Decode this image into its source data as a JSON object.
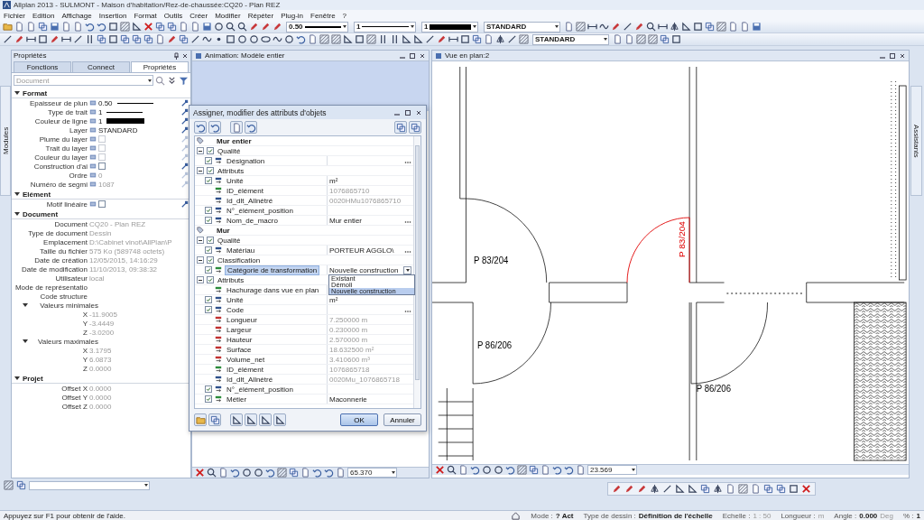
{
  "window": {
    "title": "Allplan 2013 - SULMONT - Maison d'habitation/Rez-de-chaussée:CQ20 - Plan REZ"
  },
  "menu": [
    "Fichier",
    "Edition",
    "Affichage",
    "Insertion",
    "Format",
    "Outils",
    "Créer",
    "Modifier",
    "Répéter",
    "Plug-in",
    "Fenêtre",
    "?"
  ],
  "toolbar_fields": [
    {
      "kind": "thickness",
      "value": "0.50"
    },
    {
      "kind": "linetype",
      "value": "1"
    },
    {
      "kind": "color",
      "value": "1",
      "color": "#000000"
    },
    {
      "kind": "layer",
      "value": "STANDARD"
    }
  ],
  "toolbar2_field": "STANDARD",
  "side_tabs": {
    "left": "Modules",
    "right": "Assistants"
  },
  "properties": {
    "title": "Propriétés",
    "tabs": [
      {
        "label": "Fonctions",
        "selected": false
      },
      {
        "label": "Connect",
        "selected": false
      },
      {
        "label": "Propriétés",
        "selected": true
      }
    ],
    "filter": "Document",
    "sections": [
      {
        "title": "Format",
        "kind": "format",
        "expanded": true,
        "rows": [
          {
            "kind": "line",
            "label": "Epaisseur de plun",
            "value": "0.50",
            "disabled": false
          },
          {
            "kind": "line",
            "label": "Type de trait",
            "value": "1",
            "disabled": false
          },
          {
            "kind": "color",
            "label": "Couleur de ligne",
            "value": "1",
            "color": "#000000",
            "disabled": false
          },
          {
            "kind": "text",
            "label": "Layer",
            "value": "STANDARD",
            "disabled": false
          },
          {
            "kind": "checkbox",
            "label": "Plume du layer",
            "checked": false,
            "disabled": true
          },
          {
            "kind": "checkbox",
            "label": "Trait du layer",
            "checked": false,
            "disabled": true
          },
          {
            "kind": "checkbox",
            "label": "Couleur du layer",
            "checked": false,
            "disabled": true
          },
          {
            "kind": "checkbox",
            "label": "Construction d'ai",
            "checked": false,
            "disabled": false
          },
          {
            "kind": "text",
            "label": "Ordre",
            "value": "0",
            "disabled": true
          },
          {
            "kind": "text",
            "label": "Numéro de segmi",
            "value": "1087",
            "disabled": true
          }
        ]
      },
      {
        "title": "Elément",
        "kind": "format",
        "expanded": true,
        "rows": [
          {
            "kind": "checkbox",
            "label": "Motif linéaire",
            "checked": false,
            "disabled": false
          }
        ]
      },
      {
        "title": "Document",
        "kind": "info",
        "expanded": true,
        "rows": [
          {
            "kind": "text",
            "label": "Document",
            "value": "CQ20 - Plan REZ",
            "disabled": true
          },
          {
            "kind": "text",
            "label": "Type de document",
            "value": "Dessin",
            "disabled": true
          },
          {
            "kind": "text",
            "label": "Emplacement",
            "value": "D:\\Cabinet vinot\\AllPlan\\P",
            "disabled": true
          },
          {
            "kind": "text",
            "label": "Taille du fichier",
            "value": "575 Ko (589748 octets)",
            "disabled": true
          },
          {
            "kind": "text",
            "label": "Date de création",
            "value": "12/05/2015, 14:16:29",
            "disabled": true
          },
          {
            "kind": "text",
            "label": "Date de modification",
            "value": "11/10/2013, 09:38:32",
            "disabled": true
          },
          {
            "kind": "text",
            "label": "Utilisateur",
            "value": "local",
            "disabled": true
          },
          {
            "kind": "text",
            "label": "Mode de représentatio"
          },
          {
            "kind": "text",
            "label": "Code structure"
          },
          {
            "kind": "group",
            "label": "Valeurs minimales",
            "expanded": true,
            "children": [
              {
                "label": "X",
                "value": "-11.9005",
                "disabled": true
              },
              {
                "label": "Y",
                "value": "-3.4449",
                "disabled": true
              },
              {
                "label": "Z",
                "value": "-3.0200",
                "disabled": true
              }
            ]
          },
          {
            "kind": "group",
            "label": "Valeurs maximales",
            "expanded": true,
            "children": [
              {
                "label": "X",
                "value": "3.1795",
                "disabled": true
              },
              {
                "label": "Y",
                "value": "6.0873",
                "disabled": true
              },
              {
                "label": "Z",
                "value": "0.0000",
                "disabled": true
              }
            ]
          }
        ]
      },
      {
        "title": "Projet",
        "kind": "info",
        "expanded": true,
        "rows": [
          {
            "kind": "text",
            "label": "Offset X",
            "value": "0.0000",
            "disabled": true
          },
          {
            "kind": "text",
            "label": "Offset Y",
            "value": "0.0000",
            "disabled": true
          },
          {
            "kind": "text",
            "label": "Offset Z",
            "value": "0.0000",
            "disabled": true
          }
        ]
      }
    ]
  },
  "animation_window": {
    "title": "Animation: Modèle entier",
    "zoom_field": "65.370"
  },
  "plan_window": {
    "title": "Vue en plan:2",
    "zoom_field": "23.569",
    "labels": [
      {
        "text": "P 83/204",
        "selected": false
      },
      {
        "text": "P 83/204",
        "selected": true
      },
      {
        "text": "P 86/206",
        "selected": false
      },
      {
        "text": "P 86/206",
        "selected": false
      }
    ]
  },
  "dialog": {
    "title": "Assigner, modifier des attributs d'objets",
    "objects": [
      {
        "label": "Mur entier",
        "groups": [
          {
            "label": "Qualité",
            "expanded": true,
            "checked": true,
            "children": [
              {
                "kind": "text",
                "label": "Désignation",
                "checked": true,
                "ellipsis": true,
                "selected": false
              }
            ]
          },
          {
            "label": "Attributs",
            "expanded": true,
            "checked": true,
            "children": [
              {
                "kind": "text",
                "label": "Unité",
                "checked": true,
                "value": "m²",
                "disabled": false,
                "ellipsis": false,
                "selected": false
              },
              {
                "kind": "number",
                "label": "ID_élément",
                "value": "1076865710",
                "disabled": true,
                "ellipsis": false,
                "selected": false
              },
              {
                "kind": "text",
                "label": "Id_dlt_Allnétré",
                "value": "0020HMu1076865710",
                "disabled": true,
                "ellipsis": false,
                "selected": false
              },
              {
                "kind": "text",
                "label": "N°_élément_position",
                "checked": true,
                "ellipsis": false,
                "selected": false
              },
              {
                "kind": "text",
                "label": "Nom_de_macro",
                "checked": true,
                "value": "Mur entier",
                "disabled": false,
                "ellipsis": true,
                "selected": false
              }
            ]
          }
        ]
      },
      {
        "label": "Mur",
        "groups": [
          {
            "label": "Qualité",
            "expanded": true,
            "checked": true,
            "children": [
              {
                "kind": "text",
                "label": "Matériau",
                "checked": true,
                "value": "PORTEUR AGGLO\\",
                "disabled": false,
                "ellipsis": true,
                "selected": false
              }
            ]
          },
          {
            "label": "Classification",
            "expanded": true,
            "checked": true,
            "children": [
              {
                "kind": "number",
                "label": "Catégorie de transformation",
                "checked": true,
                "value": "Nouvelle construction",
                "disabled": false,
                "ellipsis": false,
                "selected": true,
                "options": [
                  {
                    "label": "Existant",
                    "selected": false
                  },
                  {
                    "label": "Démoli",
                    "selected": false
                  },
                  {
                    "label": "Nouvelle construction",
                    "selected": true
                  }
                ]
              }
            ]
          },
          {
            "label": "Attributs",
            "expanded": true,
            "checked": true,
            "children": [
              {
                "kind": "number",
                "label": "Hachurage dans vue en plan",
                "ellipsis": false,
                "selected": false
              },
              {
                "kind": "text",
                "label": "Unité",
                "checked": true,
                "value": "m²",
                "disabled": false,
                "ellipsis": false,
                "selected": false
              },
              {
                "kind": "text",
                "label": "Code",
                "checked": true,
                "ellipsis": true,
                "selected": false
              },
              {
                "kind": "computed",
                "label": "Longueur",
                "value": "7.250000 m",
                "disabled": true,
                "ellipsis": false,
                "selected": false
              },
              {
                "kind": "computed",
                "label": "Largeur",
                "value": "0.230000 m",
                "disabled": true,
                "ellipsis": false,
                "selected": false
              },
              {
                "kind": "computed",
                "label": "Hauteur",
                "value": "2.570000 m",
                "disabled": true,
                "ellipsis": false,
                "selected": false
              },
              {
                "kind": "computed",
                "label": "Surface",
                "value": "18.632500 m²",
                "disabled": true,
                "ellipsis": false,
                "selected": false
              },
              {
                "kind": "computed",
                "label": "Volume_net",
                "value": "3.410600 m³",
                "disabled": true,
                "ellipsis": false,
                "selected": false
              },
              {
                "kind": "number",
                "label": "ID_élément",
                "value": "1076865718",
                "disabled": true,
                "ellipsis": false,
                "selected": false
              },
              {
                "kind": "text",
                "label": "Id_dlt_Allnétré",
                "value": "0020Mu_1076865718",
                "disabled": true,
                "ellipsis": false,
                "selected": false
              },
              {
                "kind": "text",
                "label": "N°_élément_position",
                "checked": true,
                "ellipsis": false,
                "selected": false
              },
              {
                "kind": "number",
                "label": "Métier",
                "checked": true,
                "value": "Maconnerie",
                "disabled": false,
                "ellipsis": false,
                "selected": false
              }
            ]
          }
        ]
      }
    ],
    "buttons": [
      {
        "label": "OK",
        "default": true
      },
      {
        "label": "Annuler",
        "default": false
      }
    ]
  },
  "status_bar": {
    "help": "Appuyez sur F1 pour obtenir de l'aide.",
    "items": [
      {
        "label": "Mode :",
        "value": "? Act",
        "disabled": false
      },
      {
        "label": "Type de dessin :",
        "value": "Définition de l'échelle",
        "disabled": false
      },
      {
        "label": "Echelle :",
        "value": "1 : 50",
        "disabled": true
      },
      {
        "label": "Longueur :",
        "value": "m",
        "disabled": true
      },
      {
        "label": "Angle :",
        "value": "0.000",
        "unit": "Deg",
        "disabled": false
      },
      {
        "label": "% :",
        "value": "1",
        "disabled": false
      }
    ]
  }
}
